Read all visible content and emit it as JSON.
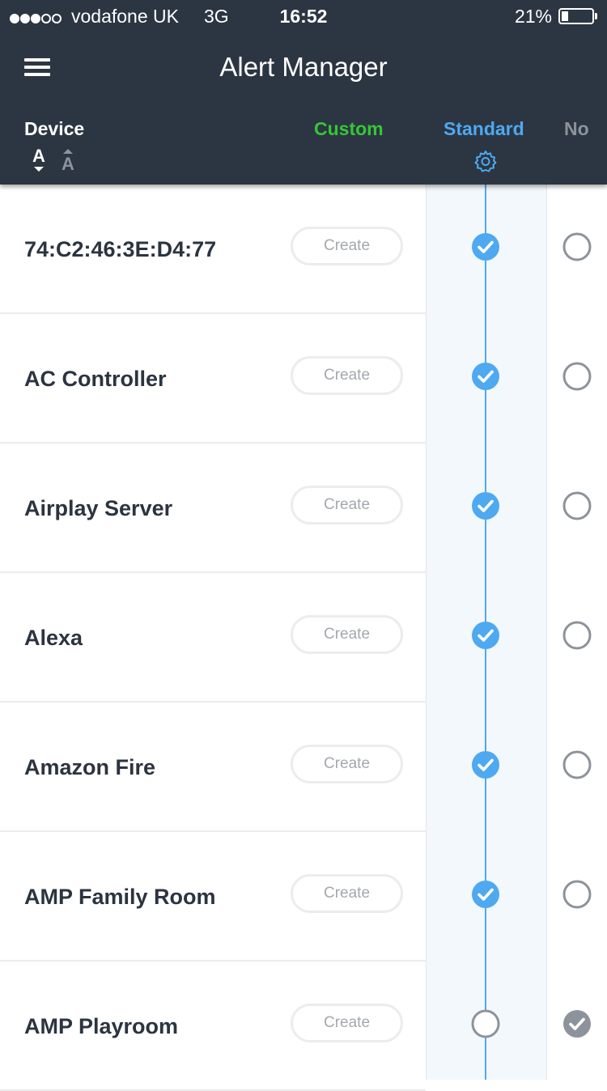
{
  "status_bar": {
    "signal_dots": [
      true,
      true,
      true,
      false,
      false
    ],
    "carrier": "vodafone UK",
    "network": "3G",
    "time": "16:52",
    "battery": "21%",
    "battery_level": 0.21
  },
  "header": {
    "menu_icon": "hamburger-icon",
    "title": "Alert Manager",
    "columns": {
      "device": "Device",
      "custom": "Custom",
      "standard": "Standard",
      "no": "No"
    },
    "sort_icons": [
      "sort-ascending-icon",
      "sort-descending-icon"
    ],
    "standard_settings_icon": "gear-icon"
  },
  "colors": {
    "header_bg": "#2c3643",
    "custom": "#35c735",
    "standard": "#4ea9f0",
    "no": "#8d939b",
    "standard_column_bg": "#f3f8fc"
  },
  "devices": [
    {
      "name": "74:C2:46:3E:D4:77",
      "custom_button": "Create",
      "selected": "standard"
    },
    {
      "name": "AC Controller",
      "custom_button": "Create",
      "selected": "standard"
    },
    {
      "name": "Airplay Server",
      "custom_button": "Create",
      "selected": "standard"
    },
    {
      "name": "Alexa",
      "custom_button": "Create",
      "selected": "standard"
    },
    {
      "name": "Amazon Fire",
      "custom_button": "Create",
      "selected": "standard"
    },
    {
      "name": "AMP Family Room",
      "custom_button": "Create",
      "selected": "standard"
    },
    {
      "name": "AMP Playroom",
      "custom_button": "Create",
      "selected": "no"
    }
  ]
}
